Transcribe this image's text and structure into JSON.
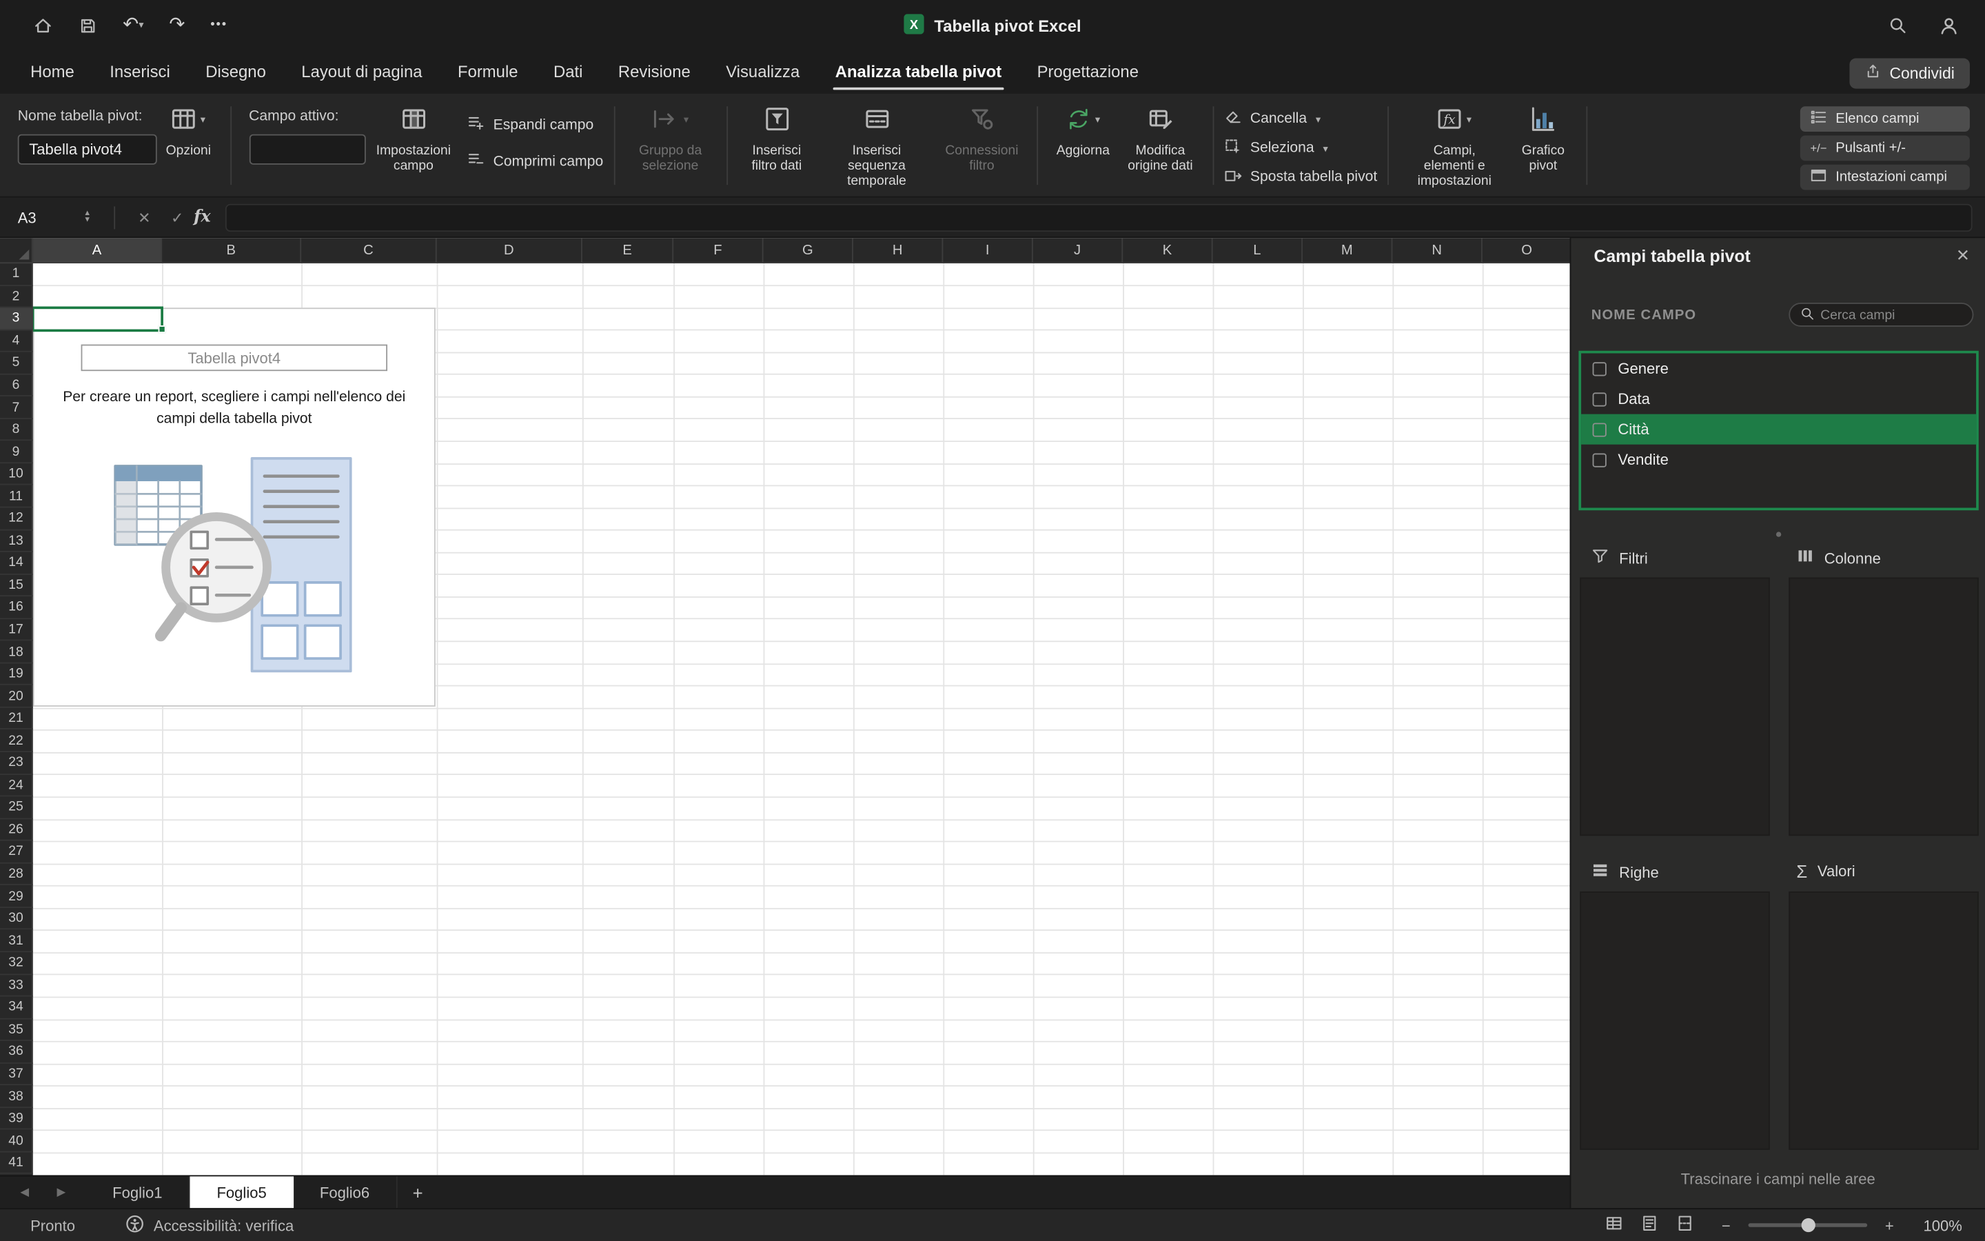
{
  "titlebar": {
    "title": "Tabella pivot Excel"
  },
  "menu": {
    "tabs": [
      {
        "label": "Home"
      },
      {
        "label": "Inserisci"
      },
      {
        "label": "Disegno"
      },
      {
        "label": "Layout di pagina"
      },
      {
        "label": "Formule"
      },
      {
        "label": "Dati"
      },
      {
        "label": "Revisione"
      },
      {
        "label": "Visualizza"
      },
      {
        "label": "Analizza tabella pivot",
        "active": true
      },
      {
        "label": "Progettazione"
      }
    ],
    "share_label": "Condividi"
  },
  "ribbon": {
    "pivot_name_label": "Nome tabella pivot:",
    "pivot_name_value": "Tabella pivot4",
    "options_label": "Opzioni",
    "active_field_label": "Campo attivo:",
    "field_settings_label": "Impostazioni campo",
    "expand_label": "Espandi campo",
    "collapse_label": "Comprimi campo",
    "group_selection_label": "Gruppo da selezione",
    "insert_slicer_label": "Inserisci filtro dati",
    "insert_timeline_label": "Inserisci sequenza temporale",
    "filter_connections_label": "Connessioni filtro",
    "refresh_label": "Aggiorna",
    "change_source_label": "Modifica origine dati",
    "clear_label": "Cancella",
    "select_label": "Seleziona",
    "move_label": "Sposta tabella pivot",
    "fields_items_label": "Campi, elementi e impostazioni",
    "pivotchart_label": "Grafico pivot",
    "field_list_label": "Elenco campi",
    "buttons_label": "Pulsanti +/-",
    "headers_label": "Intestazioni campi"
  },
  "formula_bar": {
    "cell_ref": "A3"
  },
  "sheet": {
    "columns": [
      "A",
      "B",
      "C",
      "D",
      "E",
      "F",
      "G",
      "H",
      "I",
      "J",
      "K",
      "L",
      "M",
      "N",
      "O"
    ],
    "row_count": 41,
    "selected_cell": "A3",
    "selected_col": "A",
    "selected_row": 3
  },
  "placeholder": {
    "title": "Tabella pivot4",
    "text": "Per creare un report, scegliere i campi nell'elenco dei campi della tabella pivot"
  },
  "panel": {
    "title": "Campi tabella pivot",
    "name_header": "NOME CAMPO",
    "search_placeholder": "Cerca campi",
    "fields": [
      {
        "label": "Genere"
      },
      {
        "label": "Data"
      },
      {
        "label": "Città",
        "selected": true
      },
      {
        "label": "Vendite"
      }
    ],
    "areas": {
      "filters": "Filtri",
      "columns": "Colonne",
      "rows": "Righe",
      "values": "Valori"
    },
    "hint": "Trascinare i campi nelle aree"
  },
  "sheet_tabs": {
    "items": [
      {
        "label": "Foglio1"
      },
      {
        "label": "Foglio5",
        "active": true
      },
      {
        "label": "Foglio6"
      }
    ],
    "add_label": "+"
  },
  "status_bar": {
    "ready": "Pronto",
    "accessibility": "Accessibilità: verifica",
    "zoom": "100%"
  },
  "colors": {
    "accent_green": "#1a7b43",
    "panel_highlight": "#1e7c46",
    "grid_line": "#e4e4e4"
  },
  "icons": {
    "chevron_down": "▾",
    "undo": "↶",
    "redo": "↷",
    "more": "•••",
    "cancel_x": "✕",
    "check": "✓",
    "fx": "fx",
    "stepper_up": "▲",
    "stepper_down": "▼",
    "sigma": "Σ",
    "plus": "+",
    "minus": "−",
    "nav_left": "◀",
    "nav_right": "▶",
    "close": "✕",
    "plusminus": "+/−"
  }
}
